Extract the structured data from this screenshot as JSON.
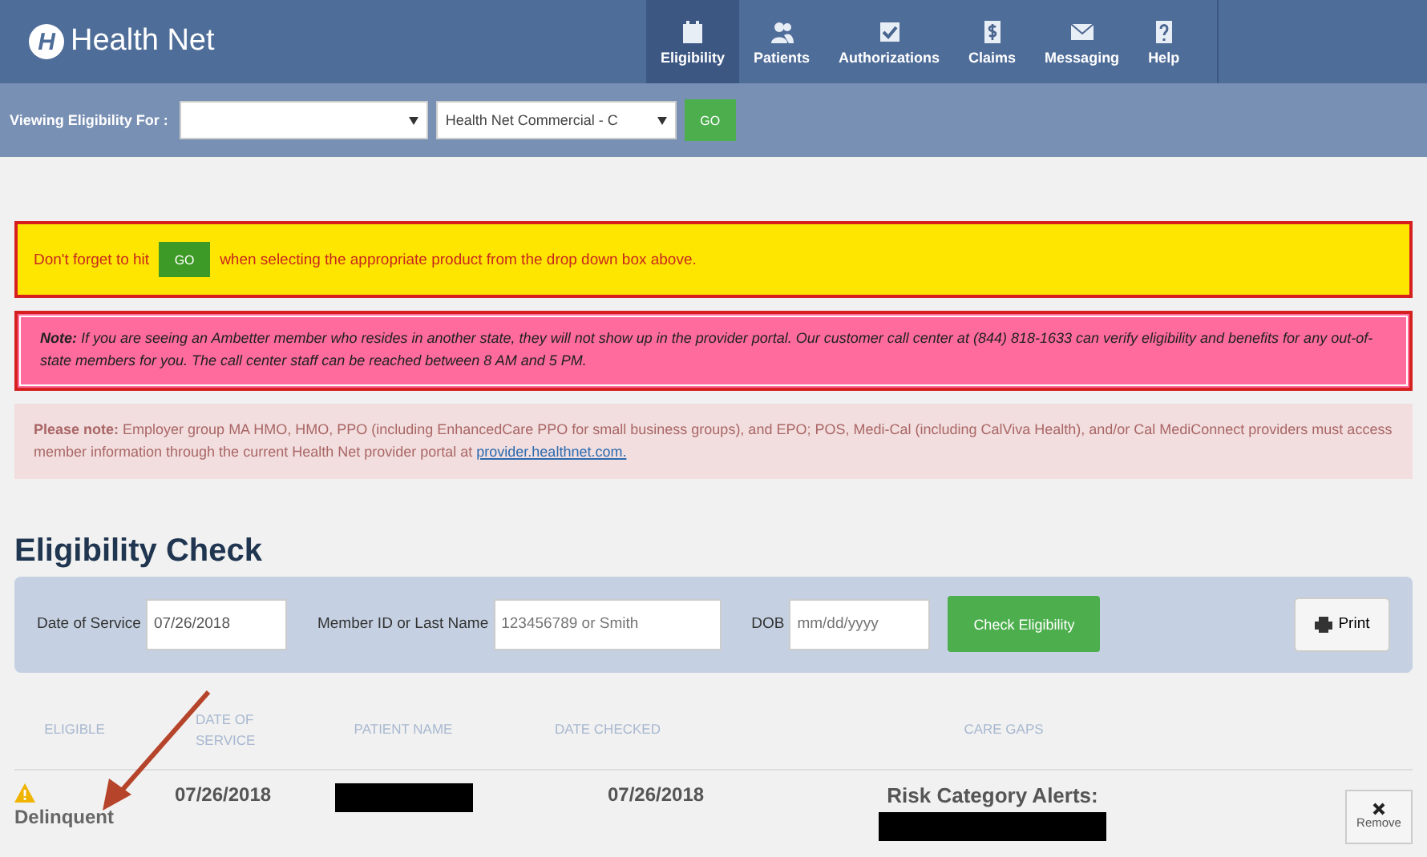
{
  "header": {
    "logo_mark": "H",
    "logo_text": "Health Net",
    "nav": [
      {
        "label": "Eligibility",
        "selected": true
      },
      {
        "label": "Patients",
        "selected": false
      },
      {
        "label": "Authorizations",
        "selected": false
      },
      {
        "label": "Claims",
        "selected": false
      },
      {
        "label": "Messaging",
        "selected": false
      },
      {
        "label": "Help",
        "selected": false
      }
    ]
  },
  "toolbar": {
    "label": "Viewing Eligibility For :",
    "product": "Health Net Commercial - C",
    "go": "GO"
  },
  "alerts": [
    {
      "kind": "go",
      "before": "Don't forget to hit",
      "button": "GO",
      "after": "when selecting the appropriate product from the drop down box above."
    },
    {
      "kind": "note",
      "text": "**Note:** If you are seeing an Ambetter member who resides in another state, they will not show up in the provider portal. Our customer call center at (844) 818-1633 can verify eligibility and benefits for any out-of-state members for you. The call center staff can be reached between 8 AM and 5 PM."
    },
    {
      "kind": "info",
      "text": "**Please note:** Employer group MA HMO, HMO, PPO (including EnhancedCare PPO for small business groups), and EPO; POS, Medi-Cal (including CalViva Health), and/or Cal MediConnect providers must access member information through the current Health Net provider portal at",
      "link": "provider.healthnet.com."
    }
  ],
  "eligibility": {
    "title": "Eligibility Check",
    "fields": [
      {
        "label": "Date of Service",
        "value": "07/26/2018"
      },
      {
        "label": "Member ID or Last Name",
        "placeholder": "123456789 or Smith"
      },
      {
        "label": "DOB",
        "placeholder": "mm/dd/yyyy"
      }
    ],
    "check_button": "Check Eligibility",
    "print_button": "Print",
    "columns": [
      "ELIGIBLE",
      "DATE OF SERVICE",
      "PATIENT NAME",
      "DATE CHECKED",
      "CARE GAPS"
    ],
    "rows": [
      {
        "status": "Delinquent",
        "date_of_service": "07/26/2018",
        "date_checked": "07/26/2018",
        "care_gaps": "Risk Category Alerts:",
        "remove": "Remove"
      }
    ]
  }
}
